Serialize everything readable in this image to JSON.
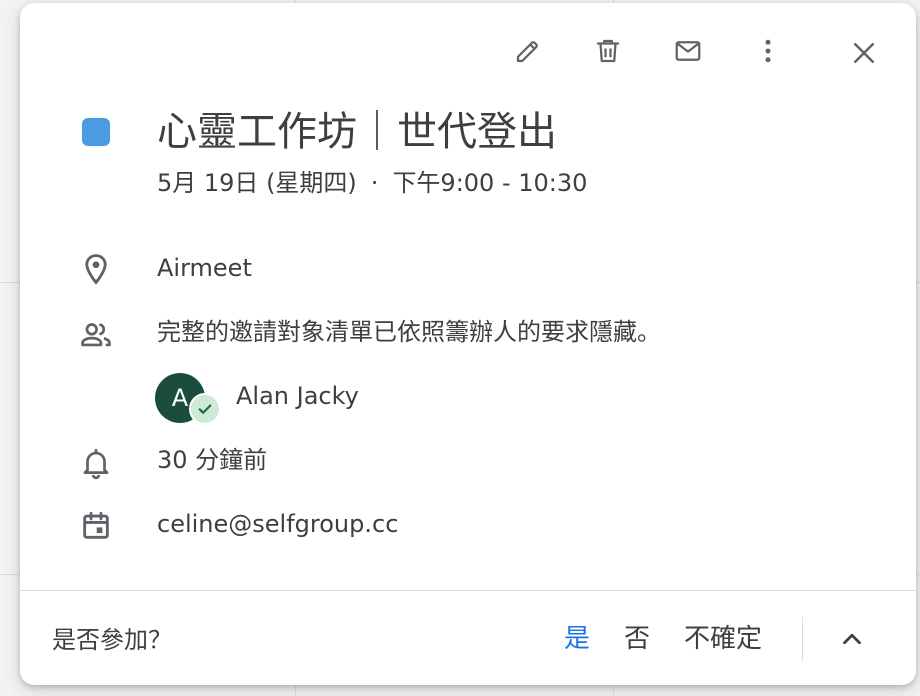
{
  "toolbar": {
    "edit_icon": "pencil-icon",
    "delete_icon": "trash-icon",
    "email_icon": "mail-icon",
    "more_icon": "more-vert-icon",
    "close_icon": "close-icon"
  },
  "event": {
    "color": "#4a9be0",
    "title": "心靈工作坊｜世代登出",
    "date": "5月 19日 (星期四)",
    "separator": "·",
    "time": "下午9:00 - 10:30"
  },
  "details": {
    "location": "Airmeet",
    "guests_note": "完整的邀請對象清單已依照籌辦人的要求隱藏。",
    "guest": {
      "initial": "A",
      "name": "Alan Jacky",
      "avatar_color": "#1b4d3e",
      "status_icon": "check-icon"
    },
    "reminder": "30 分鐘前",
    "calendar": "celine@selfgroup.cc"
  },
  "rsvp": {
    "label": "是否參加？",
    "yes": "是",
    "no": "否",
    "maybe": "不確定",
    "selected": "yes",
    "active_color": "#1a73e8",
    "expand_icon": "chevron-up-icon"
  }
}
